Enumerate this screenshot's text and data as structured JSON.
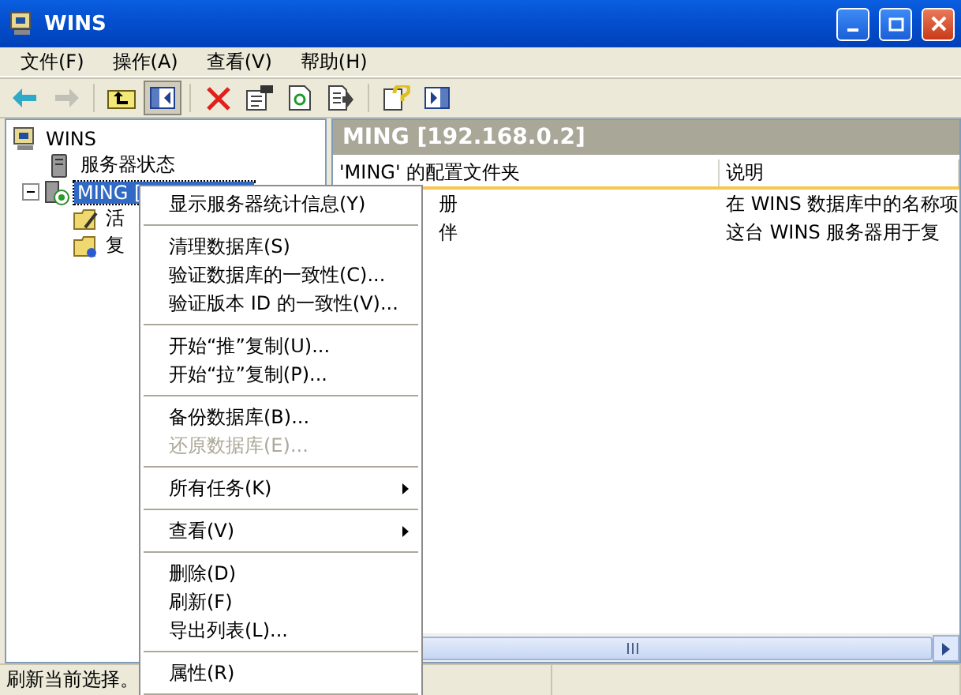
{
  "window": {
    "title": "WINS"
  },
  "menu_bar": [
    {
      "label": "文件(F)"
    },
    {
      "label": "操作(A)"
    },
    {
      "label": "查看(V)"
    },
    {
      "label": "帮助(H)"
    }
  ],
  "toolbar": [
    {
      "kind": "back",
      "disabled": false,
      "pressed": false
    },
    {
      "kind": "forward",
      "disabled": true,
      "pressed": false
    },
    {
      "kind": "separator"
    },
    {
      "kind": "up",
      "disabled": false,
      "pressed": false
    },
    {
      "kind": "tree",
      "disabled": false,
      "pressed": true
    },
    {
      "kind": "separator"
    },
    {
      "kind": "delete",
      "disabled": false,
      "pressed": false
    },
    {
      "kind": "properties",
      "disabled": false,
      "pressed": false
    },
    {
      "kind": "refresh",
      "disabled": false,
      "pressed": false
    },
    {
      "kind": "export",
      "disabled": false,
      "pressed": false
    },
    {
      "kind": "separator"
    },
    {
      "kind": "help",
      "disabled": false,
      "pressed": false
    },
    {
      "kind": "pane",
      "disabled": false,
      "pressed": false
    }
  ],
  "tree": {
    "items": [
      {
        "label": "WINS",
        "kind": "root",
        "selected": false,
        "children": [
          {
            "label": "服务器状态",
            "kind": "status",
            "selected": false
          },
          {
            "label": "MING [",
            "kind": "server",
            "selected": true,
            "expanded": true,
            "children": [
              {
                "label": "活",
                "kind": "folder-active",
                "selected": false
              },
              {
                "label": "复",
                "kind": "folder-repl",
                "selected": false
              }
            ]
          }
        ]
      }
    ]
  },
  "details": {
    "header": "MING [192.168.0.2]",
    "columns": [
      "'MING' 的配置文件夹",
      "说明"
    ],
    "rows": [
      {
        "cells": [
          "册",
          "在 WINS 数据库中的名称项"
        ]
      },
      {
        "cells": [
          "伴",
          "这台 WINS 服务器用于复"
        ]
      }
    ]
  },
  "context_menu": [
    {
      "kind": "item",
      "label": "显示服务器统计信息(Y)",
      "disabled": false,
      "submenu": false
    },
    {
      "kind": "separator"
    },
    {
      "kind": "item",
      "label": "清理数据库(S)",
      "disabled": false,
      "submenu": false
    },
    {
      "kind": "item",
      "label": "验证数据库的一致性(C)...",
      "disabled": false,
      "submenu": false
    },
    {
      "kind": "item",
      "label": "验证版本 ID 的一致性(V)...",
      "disabled": false,
      "submenu": false
    },
    {
      "kind": "separator"
    },
    {
      "kind": "item",
      "label": "开始“推”复制(U)...",
      "disabled": false,
      "submenu": false
    },
    {
      "kind": "item",
      "label": "开始“拉”复制(P)...",
      "disabled": false,
      "submenu": false
    },
    {
      "kind": "separator"
    },
    {
      "kind": "item",
      "label": "备份数据库(B)...",
      "disabled": false,
      "submenu": false
    },
    {
      "kind": "item",
      "label": "还原数据库(E)...",
      "disabled": true,
      "submenu": false
    },
    {
      "kind": "separator"
    },
    {
      "kind": "item",
      "label": "所有任务(K)",
      "disabled": false,
      "submenu": true
    },
    {
      "kind": "separator"
    },
    {
      "kind": "item",
      "label": "查看(V)",
      "disabled": false,
      "submenu": true
    },
    {
      "kind": "separator"
    },
    {
      "kind": "item",
      "label": "删除(D)",
      "disabled": false,
      "submenu": false
    },
    {
      "kind": "item",
      "label": "刷新(F)",
      "disabled": false,
      "submenu": false
    },
    {
      "kind": "item",
      "label": "导出列表(L)...",
      "disabled": false,
      "submenu": false
    },
    {
      "kind": "separator"
    },
    {
      "kind": "item",
      "label": "属性(R)",
      "disabled": false,
      "submenu": false
    },
    {
      "kind": "separator"
    }
  ],
  "status_bar": {
    "text": "刷新当前选择。"
  }
}
